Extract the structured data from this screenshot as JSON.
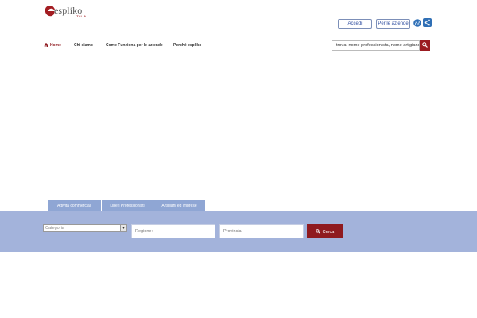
{
  "logo": {
    "text": "espliko",
    "sub": "ITALIA",
    "icon": "espliko-logo-icon"
  },
  "header": {
    "login_label": "Accedi",
    "business_label": "Per le aziende",
    "language_icon": "globe-icon",
    "share_icon": "share-icon"
  },
  "nav": {
    "items": [
      {
        "label": "Home",
        "icon": "home-icon",
        "active": true
      },
      {
        "label": "Chi siamo"
      },
      {
        "label": "Come Funziona per le aziende"
      },
      {
        "label": "Perché espliko"
      }
    ]
  },
  "search": {
    "value": "trova: nome professionista, nome artigiano",
    "button_icon": "search-icon"
  },
  "tabs": [
    {
      "label": "Attività commerciali"
    },
    {
      "label": "Liberi Professionisti"
    },
    {
      "label": "Artigiani ed imprese"
    }
  ],
  "filters": {
    "category_selected": "Categoria",
    "region_placeholder": "Regione:",
    "province_placeholder": "Provincia:",
    "submit_label": "Cerca"
  },
  "colors": {
    "brand_red": "#9b1b21",
    "band_blue": "#a3b3db",
    "tab_blue": "#8fa6d4",
    "link_blue": "#2f4ea0"
  }
}
